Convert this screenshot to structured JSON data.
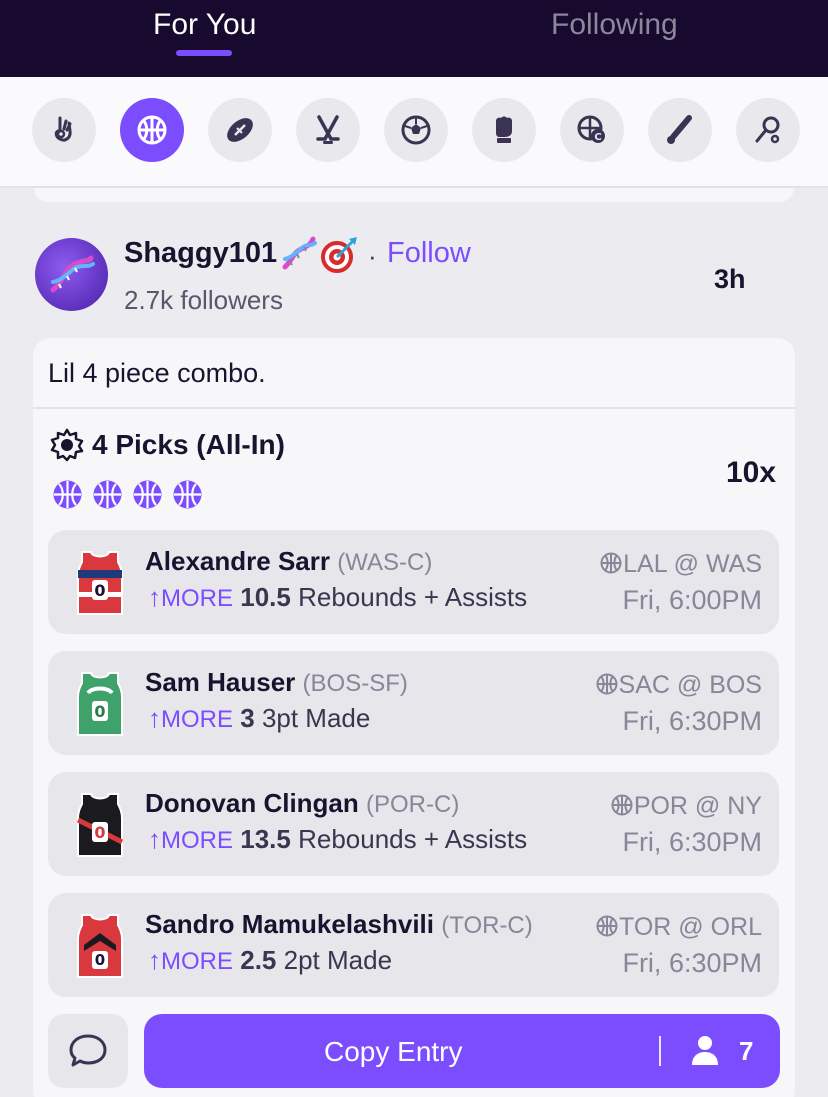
{
  "tabs": [
    {
      "label": "For You",
      "active": true
    },
    {
      "label": "Following",
      "active": false
    }
  ],
  "sports": [
    {
      "icon": "pickem-hand-icon",
      "active": false
    },
    {
      "icon": "basketball-icon",
      "active": true
    },
    {
      "icon": "football-icon",
      "active": false
    },
    {
      "icon": "hockey-sticks-icon",
      "active": false
    },
    {
      "icon": "soccer-ball-icon",
      "active": false
    },
    {
      "icon": "mma-glove-icon",
      "active": false
    },
    {
      "icon": "college-basketball-icon",
      "active": false
    },
    {
      "icon": "cricket-bat-icon",
      "active": false
    },
    {
      "icon": "golf-icon",
      "active": false
    }
  ],
  "post": {
    "username": "Shaggy101",
    "follow_label": "Follow",
    "followers": "2.7k followers",
    "time_ago": "3h",
    "caption": "Lil 4 piece combo.",
    "picks_title": "4 Picks (All-In)",
    "multiplier": "10x"
  },
  "picks": [
    {
      "name": "Alexandre Sarr",
      "pos": "(WAS-C)",
      "direction": "MORE",
      "line": "10.5",
      "stat": "Rebounds + Assists",
      "matchup": "LAL @ WAS",
      "time": "Fri, 6:00PM",
      "jersey_color": "#d9383f",
      "jersey_trim": "#1f3a7a",
      "jersey_number": "0"
    },
    {
      "name": "Sam Hauser",
      "pos": "(BOS-SF)",
      "direction": "MORE",
      "line": "3",
      "stat": "3pt Made",
      "matchup": "SAC @ BOS",
      "time": "Fri, 6:30PM",
      "jersey_color": "#3ea26a",
      "jersey_trim": "#ffffff",
      "jersey_number": "0"
    },
    {
      "name": "Donovan Clingan",
      "pos": "(POR-C)",
      "direction": "MORE",
      "line": "13.5",
      "stat": "Rebounds + Assists",
      "matchup": "POR @ NY",
      "time": "Fri, 6:30PM",
      "jersey_color": "#1b1b1f",
      "jersey_trim": "#d9383f",
      "jersey_number": "0"
    },
    {
      "name": "Sandro Mamukelashvili",
      "pos": "(TOR-C)",
      "direction": "MORE",
      "line": "2.5",
      "stat": "2pt Made",
      "matchup": "TOR @ ORL",
      "time": "Fri, 6:30PM",
      "jersey_color": "#d9383f",
      "jersey_trim": "#1b1b1f",
      "jersey_number": "0"
    }
  ],
  "actions": {
    "copy_label": "Copy Entry",
    "copy_count": "7"
  },
  "colors": {
    "accent": "#7c4dff",
    "header_bg": "#180a2e"
  }
}
